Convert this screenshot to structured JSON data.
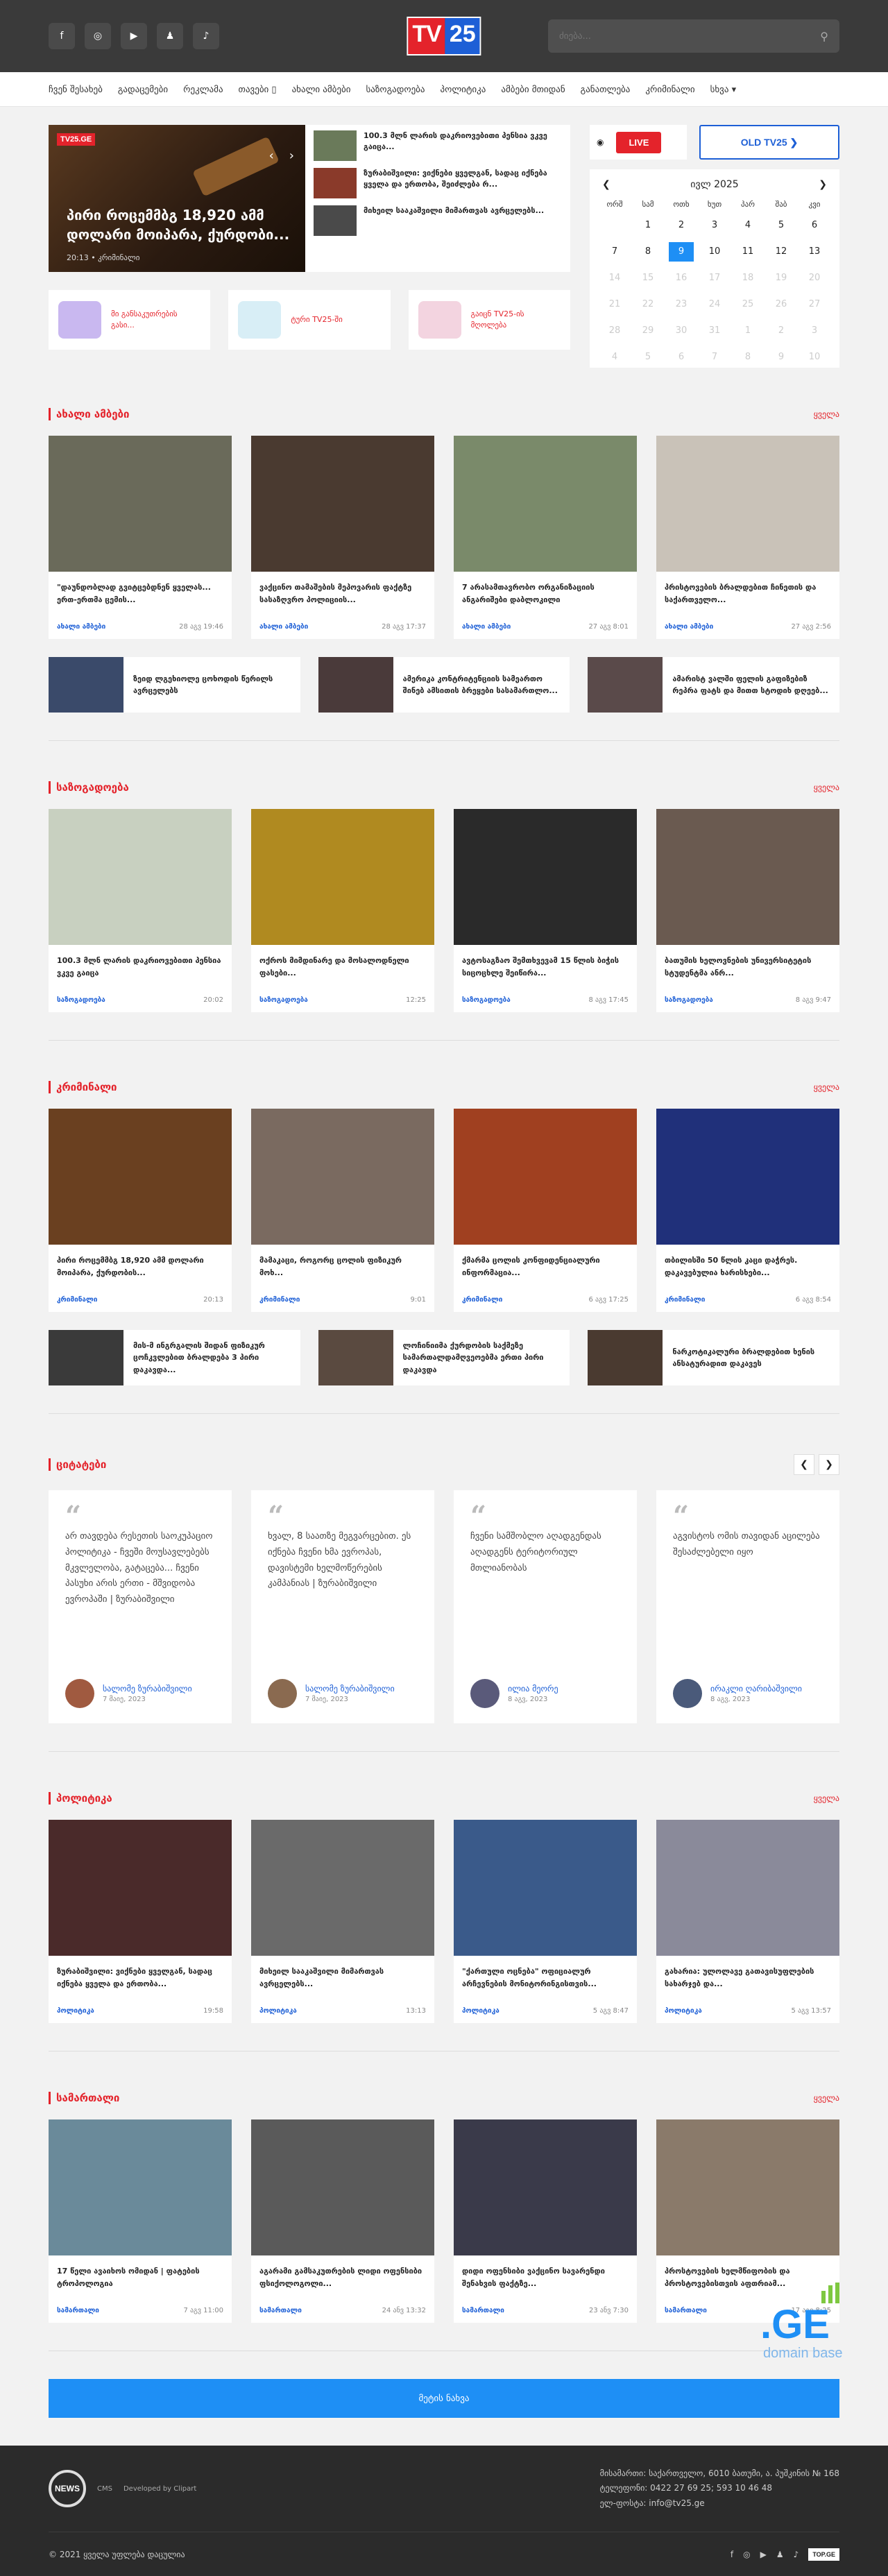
{
  "header": {
    "socials": [
      "f",
      "◎",
      "▶",
      "♟",
      "♪"
    ],
    "logo_a": "TV",
    "logo_b": "25",
    "search_placeholder": "ძიება..."
  },
  "nav": [
    "ჩვენ შესახებ",
    "გადაცემები",
    "რეკლამა",
    "თავები ▯",
    "ახალი ამბები",
    "საზოგადოება",
    "პოლიტიკა",
    "ამბები მთიდან",
    "განათლება",
    "კრიმინალი",
    "სხვა ▾"
  ],
  "hero": {
    "badge": "TV25.GE",
    "title": "პირი როცემმბგ 18,920 ამმ დოლარი მოიპარა, ქურდობი...",
    "meta": "20:13 • კრიმინალი",
    "side": [
      {
        "t": "100.3 მლნ ლარის დაკრიოვებითი პენსია ვკვე გაიცა..."
      },
      {
        "t": "ზურაბიშვილი: ვიქნები ყველგან, სადაც იქნება ყველა და ერთობა, შეიძლება რ..."
      },
      {
        "t": "მიხეილ სააკაშვილი მიმართვას ავრცელებს..."
      }
    ],
    "promos": [
      "მი განსაკუთრების გასი...",
      "ტური TV25-ში",
      "გაიცნ TV25-ის მღოლება"
    ]
  },
  "side": {
    "live": "LIVE",
    "old": "OLD TV25 ❯",
    "calendar_title": "ივლ 2025",
    "prev": "❮",
    "next": "❯",
    "dow": [
      "ორშ",
      "სამ",
      "ოთხ",
      "ხუთ",
      "პარ",
      "შაბ",
      "კვი"
    ],
    "days": [
      [
        "",
        "1",
        "2",
        "3",
        "4",
        "5",
        "6"
      ],
      [
        "7",
        "8",
        "9",
        "10",
        "11",
        "12",
        "13"
      ],
      [
        "14",
        "15",
        "16",
        "17",
        "18",
        "19",
        "20"
      ],
      [
        "21",
        "22",
        "23",
        "24",
        "25",
        "26",
        "27"
      ],
      [
        "28",
        "29",
        "30",
        "31",
        "1",
        "2",
        "3"
      ],
      [
        "4",
        "5",
        "6",
        "7",
        "8",
        "9",
        "10"
      ]
    ]
  },
  "more_label": "ყველა",
  "sections": [
    {
      "title": "ახალი ამბები",
      "cards": [
        {
          "t": "\"დაუნდობლად გვიტცებდნენ ყველას... ერთ-ერთმა ცემის...",
          "c": "ახალი ამბები",
          "d": "28 აგვ 19:46",
          "col": "#6a6a5a"
        },
        {
          "t": "ვაქცინო თამაშების მეპოვარის ფაქტზე სასაზღვრო პოლიციის...",
          "c": "ახალი ამბები",
          "d": "28 აგვ 17:37",
          "col": "#4a3a30"
        },
        {
          "t": "7 არასამთავრობო ორგანიზაციის ანგარიშები დაბლოკილი",
          "c": "ახალი ამბები",
          "d": "27 აგვ 8:01",
          "col": "#7a8a6a"
        },
        {
          "t": "პრისტოვების ბრალდებით ჩინეთის და საქართველო...",
          "c": "ახალი ამბები",
          "d": "27 აგვ 2:56",
          "col": "#c9c2b8"
        }
      ],
      "mini": [
        {
          "t": "ზეიდ ლგეხიოლე ცოხოდის წერილს ავრცელებს",
          "col": "#3a4a6a"
        },
        {
          "t": "ამერიკა კონტრიტენციის სამეართო შინებ ამსითის ბრეყები სასამართლო...",
          "col": "#4a3a3a"
        },
        {
          "t": "ამარისტ ვალში ფელის გაფიზებიზ რეპრა ფატს და მითთ სტოდიხ დღეებ...",
          "col": "#5a4a4a"
        }
      ]
    },
    {
      "title": "საზოგადოება",
      "cards": [
        {
          "t": "100.3 მლნ ლარის დაკრიოვებითი პენსია ვკვე გაიცა",
          "c": "საზოგადოება",
          "d": "20:02",
          "col": "#c8d0c0"
        },
        {
          "t": "ოქროს მიმდინარე და მოსალოდნელი ფასები...",
          "c": "საზოგადოება",
          "d": "12:25",
          "col": "#b08a20"
        },
        {
          "t": "ავტოსაგზაო შემთხვევამ 15 წლის ბიჭის სიცოცხლე შეიწირა...",
          "c": "საზოგადოება",
          "d": "8 აგვ 17:45",
          "col": "#2a2a2a"
        },
        {
          "t": "ბათუმის ხელოვნების უნივერსიტეტის სტუდენტმა ანრ...",
          "c": "საზოგადოება",
          "d": "8 აგვ 9:47",
          "col": "#6a5a50"
        }
      ],
      "mini": []
    },
    {
      "title": "კრიმინალი",
      "cards": [
        {
          "t": "პირი როცემმბგ 18,920 ამმ დოლარი მოიპარა, ქურდობის...",
          "c": "კრიმინალი",
          "d": "20:13",
          "col": "#6a4020"
        },
        {
          "t": "მამაკაცი, როგორც ცოლის ფიზიკურ მოხ...",
          "c": "კრიმინალი",
          "d": "9:01",
          "col": "#7a6a60"
        },
        {
          "t": "ქმარმა ცოლის კონფიდენციალური ინფორმაცია...",
          "c": "კრიმინალი",
          "d": "6 აგვ 17:25",
          "col": "#a04020"
        },
        {
          "t": "თბილისში 50 წლის კაცი დაჭრეს. დაკავებულია ხარისხები...",
          "c": "კრიმინალი",
          "d": "6 აგვ 8:54",
          "col": "#20307a"
        }
      ],
      "mini": [
        {
          "t": "მის-მ ინგრგალის შიდან ფიზიკურ ცოჩკვლებით ბრალდება 3 პირი დაკავდა...",
          "col": "#3a3a3a"
        },
        {
          "t": "ლოჩინიიმა ქურდობის საქმეზე სამართალდამღვეოებმა ერთი პირი დაკავდა",
          "col": "#5a4a40"
        },
        {
          "t": "ნარკოტიკალური ბრალდებით ხენის ანსატურადით დაკავეს",
          "col": "#4a3a30"
        }
      ]
    }
  ],
  "quotes": {
    "title": "ციტატები",
    "prev": "❮",
    "next": "❯",
    "items": [
      {
        "t": "არ თავდება რესეთის საოკუპაციო პოლიტიკა - ჩვეში მოუსავლებებს მკვლელობა, გატაცება... ჩვენი პასუხი არის ერთი - მშვიდობა ევროპაში | ზურაბიშვილი",
        "n": "სალომე ზურაბიშვილი",
        "d": "7 მაიე, 2023",
        "col": "#a05a40"
      },
      {
        "t": "ხვალ, 8 საათზე მეგვარცებით. ეს იქნება ჩვენი ხმა ევროპას, დავისტემი ხელმოწერების კამპანიას | ზურაბიშვილი",
        "n": "სალომე ზურაბიშვილი",
        "d": "7 მაიე, 2023",
        "col": "#8a6a50"
      },
      {
        "t": "ჩვენი სამშობლო აღადგენდას აღადგენს ტერიტორიულ მთლიანობას",
        "n": "ილია მეორე",
        "d": "8 აგვ, 2023",
        "col": "#5a5a7a"
      },
      {
        "t": "აგვისტოს ომის თავიდან აცილება შესაძლებელი იყო",
        "n": "ირაკლი ღარიბაშვილი",
        "d": "8 აგვ, 2023",
        "col": "#4a5a7a"
      }
    ]
  },
  "sections2": [
    {
      "title": "პოლიტიკა",
      "cards": [
        {
          "t": "ზურაბიშვილი: ვიქნები ყველგან, სადაც იქნება ყველა და ერთობა...",
          "c": "პოლიტიკა",
          "d": "19:58",
          "col": "#4a2a2a"
        },
        {
          "t": "მიხეილ სააკაშვილი მიმართვას ავრცელებს...",
          "c": "პოლიტიკა",
          "d": "13:13",
          "col": "#6a6a6a"
        },
        {
          "t": "\"ქართული ოცნება\" ოფიციალურ არჩევნების მონიტორინგისთვის...",
          "c": "პოლიტიკა",
          "d": "5 აგვ 8:47",
          "col": "#3a5a8a"
        },
        {
          "t": "გახარია: ულოლავე გათავისუფლების სახარჯებ და...",
          "c": "პოლიტიკა",
          "d": "5 აგვ 13:57",
          "col": "#8a8a9a"
        }
      ]
    },
    {
      "title": "სამართალი",
      "cards": [
        {
          "t": "17 წელი ავაიხოს ომიდან | ფატების ტროპოლოგია",
          "c": "სამართალი",
          "d": "7 აგვ 11:00",
          "col": "#6a8a9a"
        },
        {
          "t": "აგარამი გამსაკუთრების ლიდი ოფენსიბი ფსიქოლოგოლი...",
          "c": "სამართალი",
          "d": "24 ანვ 13:32",
          "col": "#5a5a5a"
        },
        {
          "t": "დიდი ოფენსიბი ვაქცინო სავარენდი შენახვის ფაქტზე...",
          "c": "სამართალი",
          "d": "23 ანვ 7:30",
          "col": "#3a3a4a"
        },
        {
          "t": "პროსტოვების ხელმწიფობის და პროსტოვებისთვის აფთრიამ...",
          "c": "სამართალი",
          "d": "17 აგვ 8:25",
          "col": "#8a7a6a"
        }
      ]
    }
  ],
  "more_btn": "მეტის ნახვა",
  "footer": {
    "logo": "NEWS",
    "logo_sub": "CMS",
    "dev": "Developed by Clipart",
    "contact": [
      "მისამართი: საქართველო, 6010 ბათუმი, ა. პუშკინის № 168",
      "ტელეფონი: 0422 27 69 25; 593 10 46 48",
      "ელ-ფოსტა: info@tv25.ge"
    ],
    "copy": "© 2021 ყველა უფლება დაცულია",
    "socials": [
      "f",
      "◎",
      "▶",
      "♟",
      "♪"
    ],
    "top_label": "TOP.GE"
  },
  "ge_badge": {
    "big": ".GE",
    "small": "domain base"
  }
}
